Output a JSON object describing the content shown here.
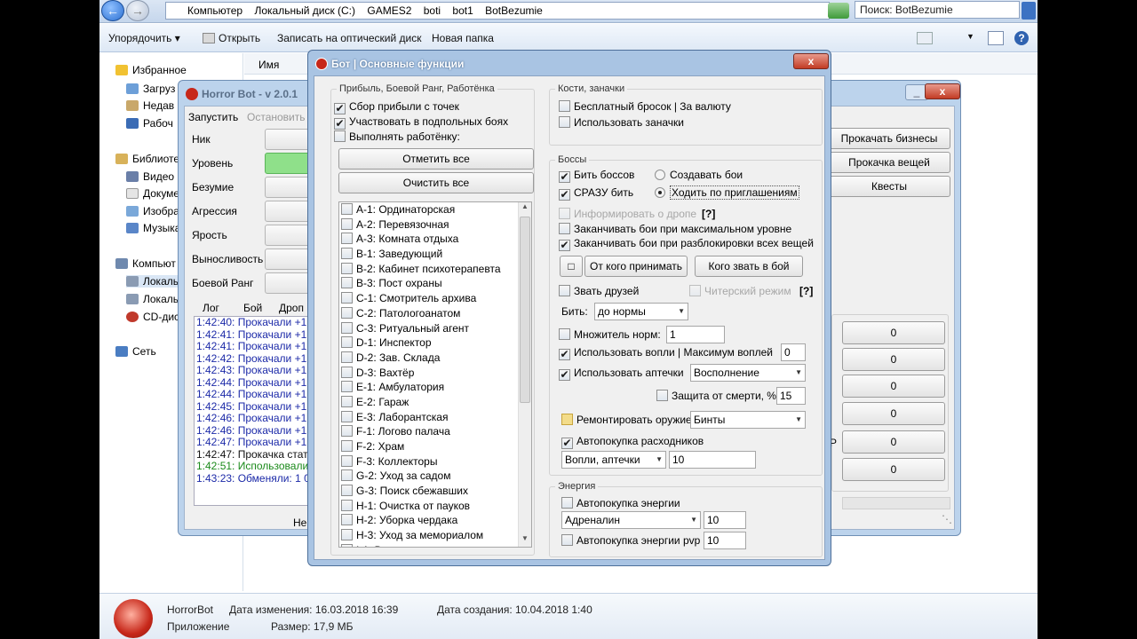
{
  "explorer": {
    "breadcrumbs": [
      "Компьютер",
      "Локальный диск (C:)",
      "GAMES2",
      "boti",
      "bot1",
      "BotBezumie"
    ],
    "search": "Поиск: BotBezumie",
    "toolbar": [
      "Упорядочить ▾",
      "Открыть",
      "Записать на оптический диск",
      "Новая папка"
    ],
    "column_name": "Имя",
    "nav": {
      "favorites": "Избранное",
      "downloads": "Загруз",
      "recent": "Недав",
      "desktop": "Рабоч",
      "libraries": "Библиоте",
      "video": "Видео",
      "docs": "Докуме",
      "images": "Изобра",
      "music": "Музыка",
      "computer": "Компьют",
      "local1": "Локаль",
      "local2": "Локаль",
      "cd": "CD-дис",
      "network": "Сеть"
    },
    "details": {
      "name": "HorrorBot",
      "type": "Приложение",
      "modified": "Дата изменения: 16.03.2018 16:39",
      "size": "Размер: 17,9 МБ",
      "created": "Дата создания: 10.04.2018 1:40"
    }
  },
  "horrorbot": {
    "title": "Horror Bot - v 2.0.1",
    "menu_start": "Запустить",
    "menu_stop": "Остановить",
    "labels": [
      "Ник",
      "Уровень",
      "Безумие",
      "Агрессия",
      "Ярость",
      "Выносливость",
      "Боевой Ранг"
    ],
    "tabs": [
      "Лог",
      "Бой",
      "Дроп"
    ],
    "log": [
      {
        "t": "1:42:40: Прокачали +1",
        "c": "#1c2aa8"
      },
      {
        "t": "1:42:41: Прокачали +1",
        "c": "#1c2aa8"
      },
      {
        "t": "1:42:41: Прокачали +1",
        "c": "#1c2aa8"
      },
      {
        "t": "1:42:42: Прокачали +1",
        "c": "#1c2aa8"
      },
      {
        "t": "1:42:43: Прокачали +1",
        "c": "#1c2aa8"
      },
      {
        "t": "1:42:44: Прокачали +1",
        "c": "#1c2aa8"
      },
      {
        "t": "1:42:44: Прокачали +1",
        "c": "#1c2aa8"
      },
      {
        "t": "1:42:45: Прокачали +1",
        "c": "#1c2aa8"
      },
      {
        "t": "1:42:46: Прокачали +1",
        "c": "#1c2aa8"
      },
      {
        "t": "1:42:46: Прокачали +1",
        "c": "#1c2aa8"
      },
      {
        "t": "1:42:47: Прокачали +1",
        "c": "#1c2aa8"
      },
      {
        "t": "1:42:47: Прокачка стат",
        "c": "#111111"
      },
      {
        "t": "1:42:51: Использовали",
        "c": "#1a8a1a"
      },
      {
        "t": "1:43:23: Обменяли: 1 00",
        "c": "#1c2aa8"
      }
    ],
    "status": "Не",
    "right_buttons": [
      "Прокачать бизнесы",
      "Прокачка вещей",
      "Квесты"
    ],
    "counters": [
      "0",
      "0",
      "0",
      "0",
      "0",
      "0"
    ],
    "arrow": "Р"
  },
  "dialog": {
    "title": "Бот | Основные функции",
    "close": "x",
    "group_profit": "Прибыль, Боевой Ранг, Работёнка",
    "profit_opts": [
      {
        "label": "Сбор прибыли с точек",
        "checked": true
      },
      {
        "label": "Участвовать в подпольных боях",
        "checked": true
      },
      {
        "label": "Выполнять работёнку:",
        "checked": false
      }
    ],
    "btn_mark_all": "Отметить все",
    "btn_clear_all": "Очистить все",
    "jobs": [
      "А-1: Ординаторская",
      "А-2: Перевязочная",
      "А-3: Комната отдыха",
      "В-1: Заведующий",
      "В-2: Кабинет психотерапевта",
      "В-3: Пост охраны",
      "С-1: Смотритель архива",
      "С-2: Патологоанатом",
      "С-3: Ритуальный агент",
      "D-1: Инспектор",
      "D-2: Зав. Склада",
      "D-3: Вахтёр",
      "Е-1: Амбулатория",
      "Е-2: Гараж",
      "Е-3: Лаборантская",
      "F-1: Логово палача",
      "F-2: Храм",
      "F-3: Коллекторы",
      "G-2: Уход за садом",
      "G-3: Поиск сбежавших",
      "Н-1: Очистка от пауков",
      "Н-2: Уборка чердака",
      "Н-3: Уход за мемориалом",
      "I-1: В"
    ],
    "group_dice": "Кости, заначки",
    "dice_opts": [
      "Бесплатный бросок | За валюту",
      "Использовать заначки"
    ],
    "group_bosses": "Боссы",
    "fight_bosses": "Бить боссов",
    "fight_now": "СРАЗУ бить",
    "radio_create": "Создавать бои",
    "radio_invite": "Ходить по приглашениям",
    "inform_drop": "Информировать о дропе",
    "help": "[?]",
    "end_max": "Заканчивать бои при максимальном уровне",
    "end_unlock": "Заканчивать бои при разблокировки всех вещей",
    "square": "□",
    "btn_accept_from": "От кого принимать",
    "btn_invite_who": "Кого звать в бой",
    "invite_friends": "Звать друзей",
    "cheat_mode": "Читерский режим",
    "hit_label": "Бить:",
    "hit_value": "до нормы",
    "mult_label": "Множитель норм:",
    "mult_value": "1",
    "use_screams": "Использовать вопли | Максимум воплей",
    "screams_max": "0",
    "use_kits": "Использовать аптечки",
    "kits_value": "Восполнение",
    "death_protect": "Защита от смерти, %",
    "death_value": "15",
    "repair": "Ремонтировать оружие",
    "repair_value": "Бинты",
    "autobuy": "Автопокупка расходников",
    "autobuy_item": "Вопли, аптечки",
    "autobuy_count": "10",
    "group_energy": "Энергия",
    "energy_autobuy": "Автопокупка энергии",
    "energy_item": "Адреналин",
    "energy_count": "10",
    "energy_pvp": "Автопокупка энергии pvp",
    "energy_pvp_count": "10"
  }
}
